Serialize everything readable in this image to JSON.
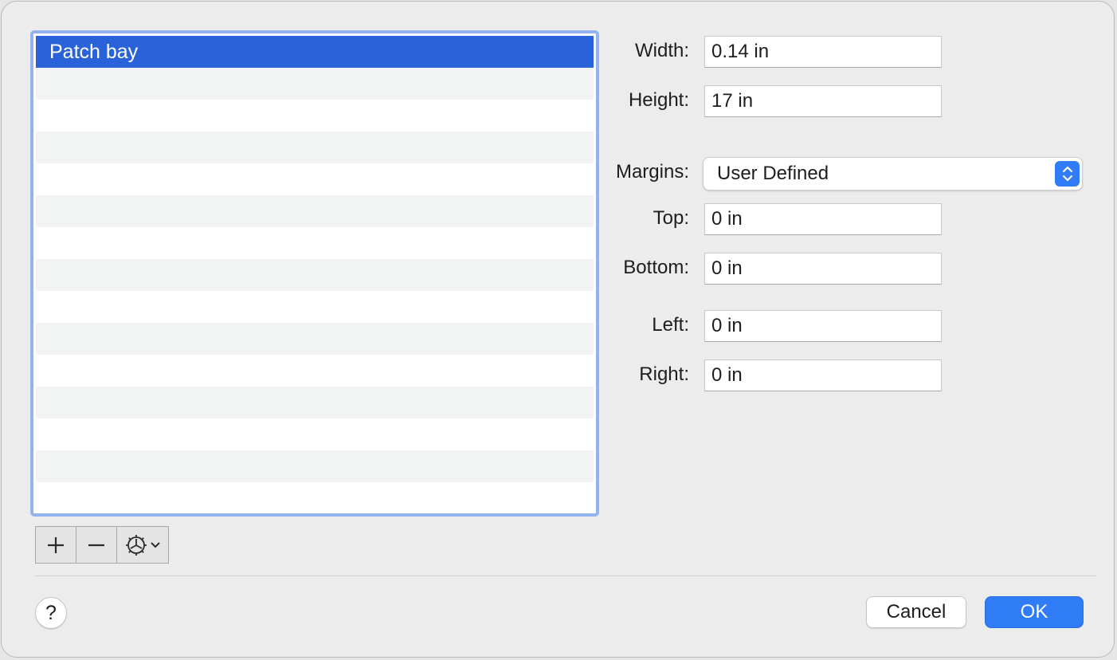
{
  "list": {
    "items": [
      {
        "label": "Patch bay",
        "selected": true
      },
      {
        "label": ""
      },
      {
        "label": ""
      },
      {
        "label": ""
      },
      {
        "label": ""
      },
      {
        "label": ""
      },
      {
        "label": ""
      },
      {
        "label": ""
      },
      {
        "label": ""
      },
      {
        "label": ""
      },
      {
        "label": ""
      },
      {
        "label": ""
      },
      {
        "label": ""
      },
      {
        "label": ""
      },
      {
        "label": ""
      }
    ]
  },
  "list_controls": {
    "add_icon": "plus-icon",
    "remove_icon": "minus-icon",
    "actions_icon": "gear-icon"
  },
  "form": {
    "width": {
      "label": "Width:",
      "value": "0.14 in"
    },
    "height": {
      "label": "Height:",
      "value": "17 in"
    },
    "margins": {
      "label": "Margins:",
      "value": "User Defined"
    },
    "top": {
      "label": "Top:",
      "value": "0 in"
    },
    "bottom": {
      "label": "Bottom:",
      "value": "0 in"
    },
    "left": {
      "label": "Left:",
      "value": "0 in"
    },
    "right": {
      "label": "Right:",
      "value": "0 in"
    }
  },
  "footer": {
    "help_label": "?",
    "cancel_label": "Cancel",
    "ok_label": "OK"
  },
  "colors": {
    "selection": "#2a63d9",
    "focus_ring": "#92b3ef",
    "accent": "#2f7cf6"
  }
}
